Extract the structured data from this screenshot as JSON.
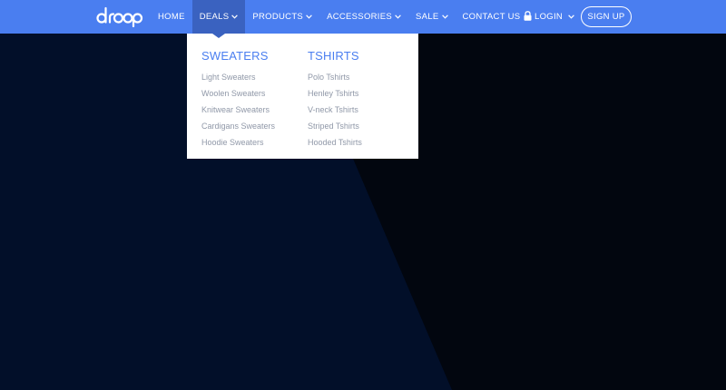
{
  "brand": {
    "logo_text": "droop"
  },
  "nav": {
    "items": [
      {
        "label": "HOME",
        "has_dropdown": false
      },
      {
        "label": "DEALS",
        "has_dropdown": true,
        "active": true
      },
      {
        "label": "PRODUCTS",
        "has_dropdown": true
      },
      {
        "label": "ACCESSORIES",
        "has_dropdown": true
      },
      {
        "label": "SALE",
        "has_dropdown": true
      },
      {
        "label": "CONTACT US",
        "has_dropdown": false
      }
    ],
    "login_label": "LOGIN",
    "signup_label": "SIGN UP"
  },
  "dropdown": {
    "columns": [
      {
        "title": "SWEATERS",
        "links": [
          "Light Sweaters",
          "Woolen Sweaters",
          "Knitwear Sweaters",
          "Cardigans Sweaters",
          "Hoodie Sweaters"
        ]
      },
      {
        "title": "TSHIRTS",
        "links": [
          "Polo Tshirts",
          "Henley Tshirts",
          "V-neck Tshirts",
          "Striped Tshirts",
          "Hooded Tshirts"
        ]
      }
    ]
  },
  "icons": {
    "lock": "lock-icon",
    "chevron": "chevron-down-icon"
  },
  "colors": {
    "navbar": "#4a7ef0",
    "navbar_active": "#3a62c0",
    "background": "#010a1e",
    "dropdown_title": "#4a7ef0",
    "dropdown_link": "#9098a8"
  }
}
